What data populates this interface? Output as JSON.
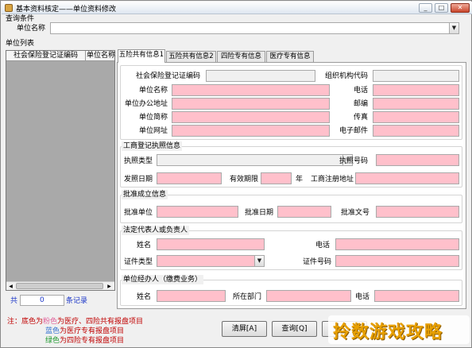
{
  "window": {
    "title": "基本资料核定——单位资料修改",
    "min": "_",
    "max": "□",
    "close": "✕"
  },
  "query": {
    "group_title": "查询条件",
    "unit_name_label": "单位名称",
    "unit_name_value": ""
  },
  "list": {
    "group_title": "单位列表",
    "columns": [
      "社会保险登记证编码",
      "单位名称"
    ],
    "count_prefix": "共",
    "count_value": "0",
    "count_suffix": "条记录"
  },
  "tabs": [
    "五险共有信息1",
    "五险共有信息2",
    "四险专有信息",
    "医疗专有信息"
  ],
  "basic": {
    "labels": [
      "社会保险登记证编码",
      "组织机构代码",
      "单位名称",
      "电话",
      "单位办公地址",
      "邮编",
      "单位简称",
      "传真",
      "单位网址",
      "电子邮件"
    ]
  },
  "license": {
    "title": "工商登记执照信息",
    "type_label": "执照类型",
    "number_label": "执照号码",
    "issue_date_label": "发照日期",
    "valid_label": "有效期限",
    "year_unit": "年",
    "reg_addr_label": "工商注册地址"
  },
  "approval": {
    "title": "批准成立信息",
    "unit_label": "批准单位",
    "date_label": "批准日期",
    "doc_label": "批准文号"
  },
  "legal": {
    "title": "法定代表人或负责人",
    "name_label": "姓名",
    "phone_label": "电话",
    "idtype_label": "证件类型",
    "idno_label": "证件号码"
  },
  "agent": {
    "title": "单位经办人（缴费业务）",
    "name_label": "姓名",
    "dept_label": "所在部门",
    "phone_label": "电话"
  },
  "notes": {
    "prefix": "注：底色为",
    "line1_color_word": "粉色",
    "line1_rest": "为医疗、四险共有报盘项目",
    "line2_color_word": "蓝色",
    "line2_rest": "为医疗专有报盘项目",
    "line3_color_word": "绿色",
    "line3_rest": "为四险专有报盘项目"
  },
  "buttons": {
    "clear": "清屏[A]",
    "query": "查询[Q]"
  },
  "watermark": "拎数游戏攻略",
  "colors": {
    "required": "#ffc0cb",
    "pink_text": "#e0609a",
    "blue_text": "#2f6fd0",
    "green_text": "#1f9a2f",
    "red_text": "#c00000"
  }
}
